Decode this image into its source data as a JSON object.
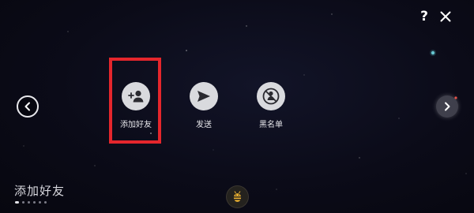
{
  "header": {
    "help_label": "?"
  },
  "actions": [
    {
      "label": "添加好友",
      "icon": "add-user-icon"
    },
    {
      "label": "发送",
      "icon": "send-icon"
    },
    {
      "label": "黑名单",
      "icon": "blacklist-icon"
    }
  ],
  "footer": {
    "title": "添加好友",
    "page_count": 6,
    "current_page": 1,
    "logo_icon": "bee-logo-icon"
  },
  "colors": {
    "background": "#0b0b16",
    "action_circle": "#d9dade",
    "highlight": "#e5262c",
    "text": "#e6e6ea",
    "logo_accent": "#f2b632"
  }
}
